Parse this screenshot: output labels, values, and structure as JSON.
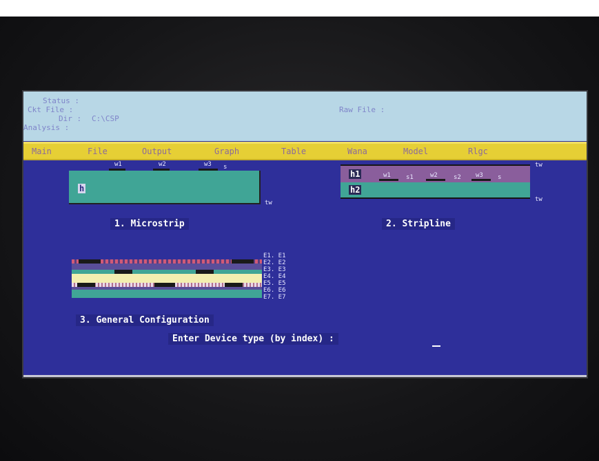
{
  "status": {
    "status_label": "Status :",
    "ckt_file_label": "Ckt File :",
    "dir_label": "Dir :",
    "dir_value": "C:\\CSP",
    "analysis_label": "Analysis :",
    "raw_file_label": "Raw File :"
  },
  "menu": [
    "Main",
    "File",
    "Output",
    "Graph",
    "Table",
    "Wana",
    "Model",
    "Rlgc"
  ],
  "microstrip": {
    "label": "1. Microstrip",
    "w_labels": [
      "w1",
      "w2",
      "w3"
    ],
    "s_label": "s",
    "h_label": "h",
    "t_label": "tw"
  },
  "stripline": {
    "label": "2. Stripline",
    "h1": "h1",
    "h2": "h2",
    "inner": [
      "w1",
      "s1",
      "w2",
      "s2",
      "w3",
      "s"
    ],
    "t_top": "tw",
    "t_bottom": "tw"
  },
  "general": {
    "label": "3. General Configuration",
    "layers": [
      "E1. E1",
      "E2. E2",
      "E3. E3",
      "E4. E4",
      "E5. E5",
      "E6. E6",
      "E7. E7"
    ]
  },
  "prompt": "Enter Device type (by index) :",
  "colors": {
    "screen_bg": "#2e2f9a",
    "status_bg": "#b8d7e6",
    "menu_bg": "#e6cf35",
    "substrate": "#40a596",
    "stripline_top": "#8a5e9c",
    "dielectric_yellow": "#f3eeb0"
  }
}
